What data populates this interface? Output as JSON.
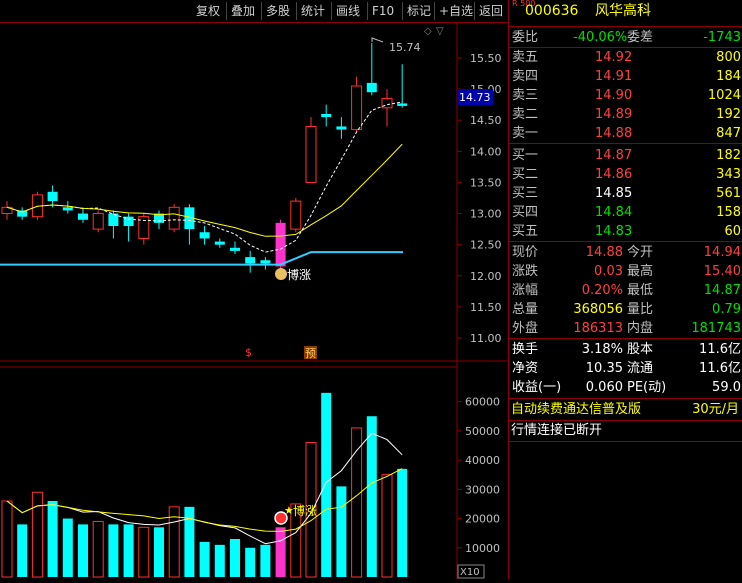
{
  "toolbar": {
    "buttons": [
      "复权",
      "叠加",
      "多股",
      "统计",
      "画线",
      "F10",
      "标记",
      "+自选",
      "返回"
    ]
  },
  "chart": {
    "price_axis": [
      "15.50",
      "15.00",
      "14.50",
      "14.00",
      "13.50",
      "13.00",
      "12.50",
      "12.00",
      "11.50",
      "11.00"
    ],
    "current_price_tag": "14.73",
    "high_marker": "15.74",
    "signal_label": "博涨",
    "event_markers": [
      "$",
      "预"
    ],
    "volume_axis": [
      "60000",
      "50000",
      "40000",
      "30000",
      "20000",
      "10000"
    ],
    "volume_unit": "X10",
    "colors": {
      "up": "#ff3030",
      "down": "#00ffff",
      "ma5": "#ffffff",
      "ma10": "#ffff00",
      "pink": "#ff33cc",
      "line": "#33ccff"
    }
  },
  "chart_data": {
    "type": "candlestick",
    "price_ylim": [
      11.0,
      15.8
    ],
    "candles": [
      {
        "o": 13.0,
        "c": 13.1,
        "h": 13.2,
        "l": 12.9,
        "up": true
      },
      {
        "o": 13.05,
        "c": 12.95,
        "h": 13.1,
        "l": 12.9,
        "up": false
      },
      {
        "o": 12.95,
        "c": 13.3,
        "h": 13.35,
        "l": 12.9,
        "up": true
      },
      {
        "o": 13.35,
        "c": 13.2,
        "h": 13.45,
        "l": 13.1,
        "up": false
      },
      {
        "o": 13.1,
        "c": 13.05,
        "h": 13.2,
        "l": 13.0,
        "up": false
      },
      {
        "o": 13.0,
        "c": 12.9,
        "h": 13.1,
        "l": 12.85,
        "up": false
      },
      {
        "o": 12.75,
        "c": 13.0,
        "h": 13.05,
        "l": 12.7,
        "up": true
      },
      {
        "o": 13.0,
        "c": 12.8,
        "h": 13.05,
        "l": 12.6,
        "up": false
      },
      {
        "o": 12.95,
        "c": 12.8,
        "h": 13.0,
        "l": 12.55,
        "up": false
      },
      {
        "o": 12.6,
        "c": 12.95,
        "h": 13.0,
        "l": 12.5,
        "up": true
      },
      {
        "o": 13.0,
        "c": 12.85,
        "h": 13.05,
        "l": 12.75,
        "up": false
      },
      {
        "o": 12.75,
        "c": 13.1,
        "h": 13.15,
        "l": 12.7,
        "up": true
      },
      {
        "o": 13.1,
        "c": 12.75,
        "h": 13.15,
        "l": 12.5,
        "up": false
      },
      {
        "o": 12.7,
        "c": 12.6,
        "h": 12.8,
        "l": 12.5,
        "up": false
      },
      {
        "o": 12.55,
        "c": 12.5,
        "h": 12.6,
        "l": 12.45,
        "up": false
      },
      {
        "o": 12.45,
        "c": 12.4,
        "h": 12.55,
        "l": 12.35,
        "up": false
      },
      {
        "o": 12.3,
        "c": 12.2,
        "h": 12.4,
        "l": 12.05,
        "up": false
      },
      {
        "o": 12.25,
        "c": 12.2,
        "h": 12.3,
        "l": 12.1,
        "up": false
      },
      {
        "o": 12.15,
        "c": 12.85,
        "h": 12.9,
        "l": 12.1,
        "up": true,
        "pink": true
      },
      {
        "o": 12.75,
        "c": 13.2,
        "h": 13.25,
        "l": 12.7,
        "up": true
      },
      {
        "o": 13.5,
        "c": 14.4,
        "h": 14.55,
        "l": 13.5,
        "up": true
      },
      {
        "o": 14.6,
        "c": 14.55,
        "h": 14.75,
        "l": 14.4,
        "up": false
      },
      {
        "o": 14.4,
        "c": 14.35,
        "h": 14.55,
        "l": 14.2,
        "up": false
      },
      {
        "o": 14.35,
        "c": 15.05,
        "h": 15.2,
        "l": 14.3,
        "up": true
      },
      {
        "o": 15.1,
        "c": 14.95,
        "h": 15.74,
        "l": 14.9,
        "up": false
      },
      {
        "o": 14.7,
        "c": 14.85,
        "h": 15.0,
        "l": 14.4,
        "up": true
      },
      {
        "o": 14.73,
        "c": 14.77,
        "h": 15.4,
        "l": 14.7,
        "up": false
      }
    ],
    "volume_ylim": [
      0,
      68000
    ],
    "volumes": [
      {
        "v": 26000,
        "up": true
      },
      {
        "v": 18000,
        "up": false
      },
      {
        "v": 29000,
        "up": true
      },
      {
        "v": 26000,
        "up": false
      },
      {
        "v": 20000,
        "up": false
      },
      {
        "v": 18000,
        "up": false
      },
      {
        "v": 19000,
        "up": true
      },
      {
        "v": 18000,
        "up": false
      },
      {
        "v": 18000,
        "up": false
      },
      {
        "v": 17000,
        "up": true
      },
      {
        "v": 17000,
        "up": false
      },
      {
        "v": 24000,
        "up": true
      },
      {
        "v": 24000,
        "up": false
      },
      {
        "v": 12000,
        "up": false
      },
      {
        "v": 11000,
        "up": false
      },
      {
        "v": 13000,
        "up": false
      },
      {
        "v": 10000,
        "up": false
      },
      {
        "v": 11000,
        "up": false
      },
      {
        "v": 17000,
        "up": true,
        "pink": true
      },
      {
        "v": 25000,
        "up": true
      },
      {
        "v": 46000,
        "up": true
      },
      {
        "v": 63000,
        "up": false
      },
      {
        "v": 31000,
        "up": false
      },
      {
        "v": 51000,
        "up": true
      },
      {
        "v": 55000,
        "up": false
      },
      {
        "v": 35000,
        "up": true
      },
      {
        "v": 37000,
        "up": false
      }
    ]
  },
  "quote": {
    "logo": "R 500",
    "code": "000636",
    "name": "风华高科",
    "weibi_label": "委比",
    "weibi_value": "-40.06%",
    "weicha_label": "委差",
    "weicha_value": "-1743",
    "asks": [
      {
        "label": "卖五",
        "price": "14.92",
        "vol": "800"
      },
      {
        "label": "卖四",
        "price": "14.91",
        "vol": "184"
      },
      {
        "label": "卖三",
        "price": "14.90",
        "vol": "1024"
      },
      {
        "label": "卖二",
        "price": "14.89",
        "vol": "192"
      },
      {
        "label": "卖一",
        "price": "14.88",
        "vol": "847"
      }
    ],
    "bids": [
      {
        "label": "买一",
        "price": "14.87",
        "vol": "182"
      },
      {
        "label": "买二",
        "price": "14.86",
        "vol": "343"
      },
      {
        "label": "买三",
        "price": "14.85",
        "vol": "561"
      },
      {
        "label": "买四",
        "price": "14.84",
        "vol": "158"
      },
      {
        "label": "买五",
        "price": "14.83",
        "vol": "60"
      }
    ],
    "stats": [
      {
        "l1": "现价",
        "v1": "14.88",
        "l2": "今开",
        "v2": "14.94"
      },
      {
        "l1": "涨跌",
        "v1": "0.03",
        "l2": "最高",
        "v2": "15.40"
      },
      {
        "l1": "涨幅",
        "v1": "0.20%",
        "l2": "最低",
        "v2": "14.87"
      },
      {
        "l1": "总量",
        "v1": "368056",
        "l2": "量比",
        "v2": "0.79"
      },
      {
        "l1": "外盘",
        "v1": "186313",
        "l2": "内盘",
        "v2": "181743"
      }
    ],
    "fund": [
      {
        "l1": "换手",
        "v1": "3.18%",
        "l2": "股本",
        "v2": "11.6亿"
      },
      {
        "l1": "净资",
        "v1": "10.35",
        "l2": "流通",
        "v2": "11.6亿"
      },
      {
        "l1": "收益(一)",
        "v1": "0.060",
        "l2": "PE(动)",
        "v2": "59.0"
      }
    ],
    "promo": "自动续费通达信普及版",
    "promo_price": "30元/月",
    "status": "行情连接已断开"
  }
}
